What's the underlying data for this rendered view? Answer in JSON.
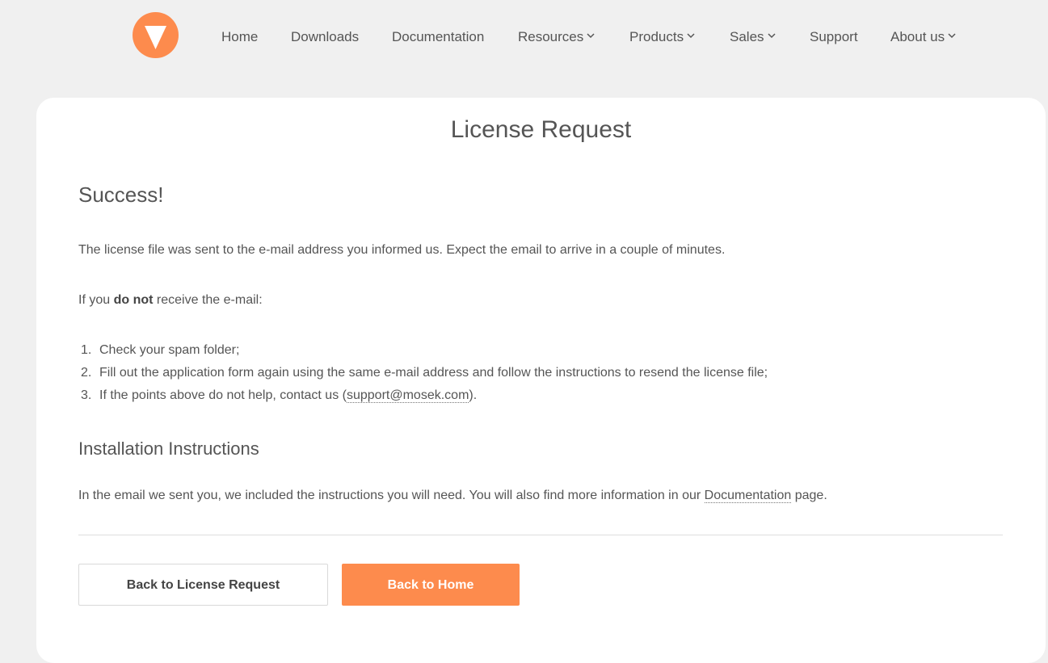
{
  "header": {
    "logo_icon": "mosek-logo-icon",
    "nav": [
      {
        "label": "Home",
        "dropdown": false
      },
      {
        "label": "Downloads",
        "dropdown": false
      },
      {
        "label": "Documentation",
        "dropdown": false
      },
      {
        "label": "Resources",
        "dropdown": true
      },
      {
        "label": "Products",
        "dropdown": true
      },
      {
        "label": "Sales",
        "dropdown": true
      },
      {
        "label": "Support",
        "dropdown": false
      },
      {
        "label": "About us",
        "dropdown": true
      }
    ]
  },
  "main": {
    "title": "License Request",
    "success_heading": "Success!",
    "sent_message": "The license file was sent to the e-mail address you informed us. Expect the email to arrive in a couple of minutes.",
    "if_not_prefix": "If you",
    "if_not_bold": "do not",
    "if_not_suffix": "receive the e-mail:",
    "steps": [
      {
        "num": "1.",
        "text": "Check your spam folder;"
      },
      {
        "num": "2.",
        "text": "Fill out the application form again using the same e-mail address and follow the instructions to resend the license file;"
      },
      {
        "num": "3.",
        "text_before": "If the points above do not help, contact us (",
        "link": "support@mosek.com",
        "text_after": ")."
      }
    ],
    "install_heading": "Installation Instructions",
    "install_text_before": "In the email we sent you, we included the instructions you will need. You will also find more information in our",
    "install_link": "Documentation",
    "install_text_after": "page."
  },
  "buttons": {
    "back_license": "Back to License Request",
    "back_home": "Back to Home"
  },
  "colors": {
    "accent": "#fd8b4d",
    "background": "#f0f0f0",
    "card": "#ffffff",
    "text": "#555555"
  }
}
